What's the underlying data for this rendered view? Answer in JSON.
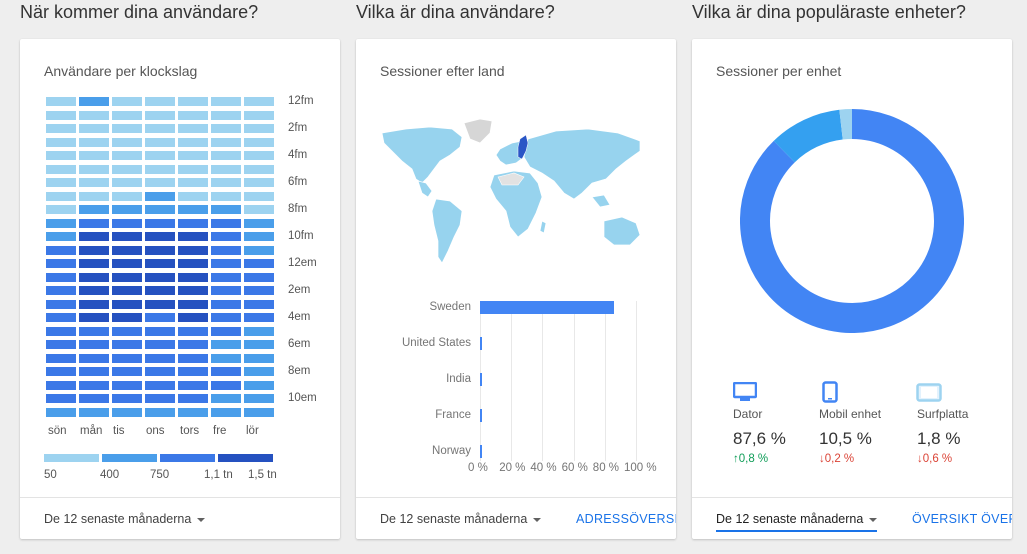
{
  "sections": {
    "when": "När kommer dina användare?",
    "who": "Vilka är dina användare?",
    "devices": "Vilka är dina populäraste enheter?"
  },
  "hours_card": {
    "title": "Användare per klockslag",
    "hour_labels": [
      "12fm",
      "2fm",
      "4fm",
      "6fm",
      "8fm",
      "10fm",
      "12em",
      "2em",
      "4em",
      "6em",
      "8em",
      "10em"
    ],
    "day_labels": [
      "sön",
      "mån",
      "tis",
      "ons",
      "tors",
      "fre",
      "lör"
    ],
    "legend": [
      "50",
      "400",
      "750",
      "1,1 tn",
      "1,5 tn"
    ],
    "legend_colors": [
      "#9dd3f0",
      "#4a9eea",
      "#3b78e7",
      "#2551c0"
    ],
    "levels": [
      [
        0,
        1,
        0,
        0,
        0,
        0,
        0
      ],
      [
        0,
        0,
        0,
        0,
        0,
        0,
        0
      ],
      [
        0,
        0,
        0,
        0,
        0,
        0,
        0
      ],
      [
        0,
        0,
        0,
        0,
        0,
        0,
        0
      ],
      [
        0,
        0,
        0,
        0,
        0,
        0,
        0
      ],
      [
        0,
        0,
        0,
        0,
        0,
        0,
        0
      ],
      [
        0,
        0,
        0,
        0,
        0,
        0,
        0
      ],
      [
        0,
        0,
        0,
        1,
        0,
        0,
        0
      ],
      [
        0,
        1,
        1,
        1,
        1,
        1,
        0
      ],
      [
        1,
        2,
        2,
        2,
        2,
        2,
        1
      ],
      [
        1,
        3,
        3,
        3,
        3,
        2,
        1
      ],
      [
        2,
        3,
        3,
        3,
        3,
        2,
        1
      ],
      [
        2,
        3,
        3,
        3,
        3,
        2,
        2
      ],
      [
        2,
        3,
        3,
        3,
        3,
        2,
        2
      ],
      [
        2,
        3,
        3,
        3,
        3,
        2,
        2
      ],
      [
        2,
        3,
        3,
        3,
        3,
        2,
        2
      ],
      [
        2,
        3,
        3,
        2,
        3,
        2,
        2
      ],
      [
        2,
        2,
        2,
        2,
        2,
        2,
        1
      ],
      [
        2,
        2,
        2,
        2,
        2,
        1,
        1
      ],
      [
        2,
        2,
        2,
        2,
        2,
        1,
        1
      ],
      [
        2,
        2,
        2,
        2,
        2,
        2,
        1
      ],
      [
        2,
        2,
        2,
        2,
        2,
        2,
        1
      ],
      [
        2,
        2,
        2,
        2,
        2,
        1,
        1
      ],
      [
        1,
        1,
        1,
        1,
        1,
        1,
        1
      ]
    ],
    "range": "De 12 senaste månaderna"
  },
  "country_card": {
    "title": "Sessioner efter land",
    "countries": [
      "Sweden",
      "United States",
      "India",
      "France",
      "Norway"
    ],
    "values": [
      86,
      1,
      1,
      1,
      1
    ],
    "axis_ticks": [
      "0 %",
      "20 %",
      "40 %",
      "60 %",
      "80 %",
      "100 %"
    ],
    "range": "De 12 senaste månaderna",
    "link": "ADRESSÖVERSIKT"
  },
  "device_card": {
    "title": "Sessioner per enhet",
    "devices": [
      {
        "label": "Dator",
        "value": "87,6 %",
        "delta": "0,8 %",
        "direction": "up",
        "icon": "desktop-icon",
        "color": "#4285f4"
      },
      {
        "label": "Mobil enhet",
        "value": "10,5 %",
        "delta": "0,2 %",
        "direction": "down",
        "icon": "mobile-icon",
        "color": "#34a0f0"
      },
      {
        "label": "Surfplatta",
        "value": "1,8 %",
        "delta": "0,6 %",
        "direction": "down",
        "icon": "tablet-icon",
        "color": "#9dd3f0"
      }
    ],
    "shares": [
      87.6,
      10.5,
      1.8
    ],
    "range": "De 12 senaste månaderna",
    "link": "ÖVERSIKT ÖVER"
  }
}
